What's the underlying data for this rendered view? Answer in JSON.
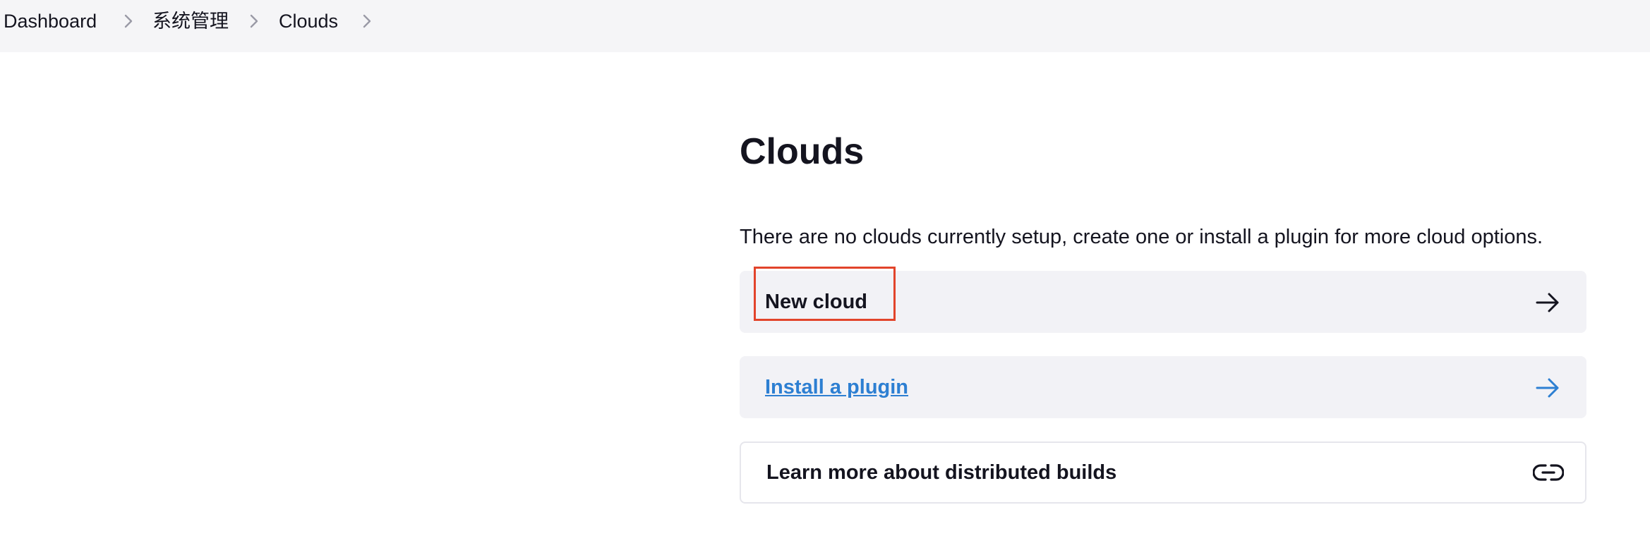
{
  "breadcrumb": {
    "items": [
      "Dashboard",
      "系统管理",
      "Clouds"
    ]
  },
  "page": {
    "title": "Clouds",
    "description": "There are no clouds currently setup, create one or install a plugin for more cloud options."
  },
  "actions": {
    "new_cloud": {
      "label": "New cloud",
      "icon": "arrow-right-icon"
    },
    "install_plugin": {
      "label": "Install a plugin",
      "icon": "arrow-right-icon"
    },
    "learn_more": {
      "label": "Learn more about distributed builds",
      "icon": "link-icon"
    }
  },
  "colors": {
    "topbar_bg": "#f5f5f7",
    "card_bg": "#f2f2f6",
    "link": "#2d7fd2",
    "highlight": "#e2442b"
  }
}
